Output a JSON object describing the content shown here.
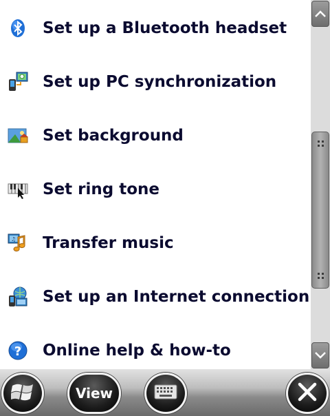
{
  "menu": {
    "items": [
      {
        "label": "Set up a Bluetooth headset",
        "icon": "bluetooth-icon"
      },
      {
        "label": "Set up PC synchronization",
        "icon": "pc-sync-icon"
      },
      {
        "label": "Set background",
        "icon": "background-image-icon"
      },
      {
        "label": "Set ring tone",
        "icon": "ring-tone-icon"
      },
      {
        "label": "Transfer music",
        "icon": "music-transfer-icon"
      },
      {
        "label": "Set up an Internet connection",
        "icon": "internet-connection-icon"
      },
      {
        "label": "Online help & how-to",
        "icon": "help-icon"
      }
    ]
  },
  "scrollbar": {
    "up_icon": "chevron-up-icon",
    "down_icon": "chevron-down-icon"
  },
  "bottombar": {
    "view_label": "View",
    "start_icon": "windows-logo-icon",
    "keyboard_icon": "keyboard-icon",
    "close_icon": "close-icon"
  },
  "colors": {
    "label_text": "#0b0b30",
    "background": "#ffffff",
    "scrollbar_track": "#dcdcdc"
  }
}
